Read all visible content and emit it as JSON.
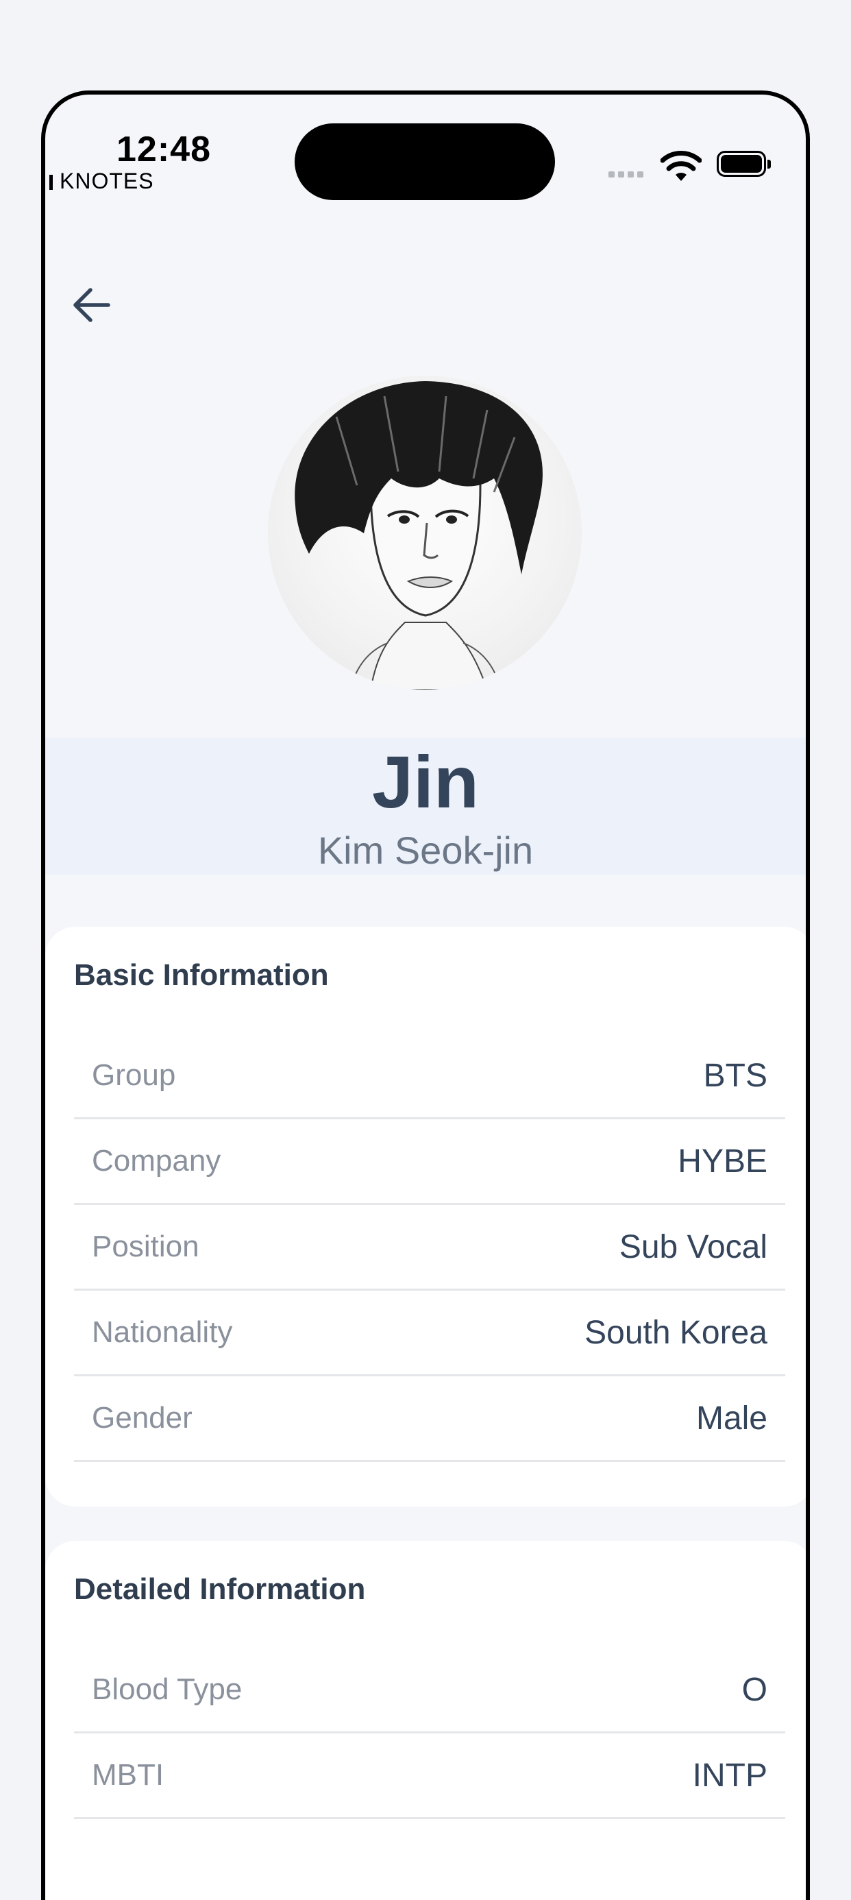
{
  "status_bar": {
    "time": "12:48",
    "carrier": "KNOTES"
  },
  "profile": {
    "name": "Jin",
    "full_name": "Kim Seok-jin"
  },
  "basic_info": {
    "title": "Basic Information",
    "rows": [
      {
        "label": "Group",
        "value": "BTS"
      },
      {
        "label": "Company",
        "value": "HYBE"
      },
      {
        "label": "Position",
        "value": "Sub Vocal"
      },
      {
        "label": "Nationality",
        "value": "South Korea"
      },
      {
        "label": "Gender",
        "value": "Male"
      }
    ]
  },
  "detailed_info": {
    "title": "Detailed Information",
    "rows": [
      {
        "label": "Blood Type",
        "value": "O"
      },
      {
        "label": "MBTI",
        "value": "INTP"
      }
    ]
  },
  "icons": {
    "back": "arrow-left-icon",
    "wifi": "wifi-icon",
    "battery": "battery-icon",
    "signal": "signal-icon"
  },
  "colors": {
    "text_primary": "#34445a",
    "text_label": "#8a919c",
    "background": "#f4f6fa",
    "card": "#ffffff"
  }
}
